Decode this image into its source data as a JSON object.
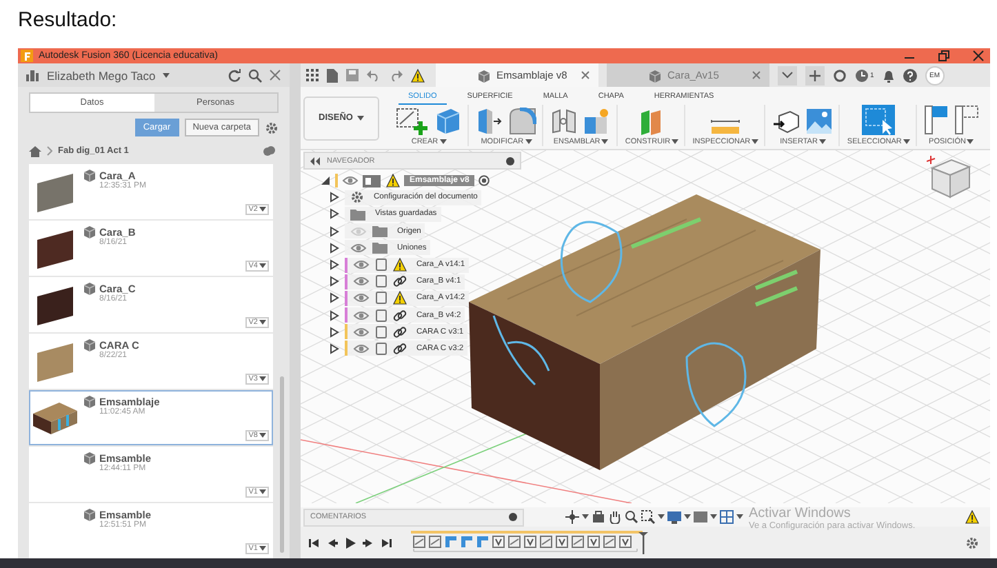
{
  "heading": "Resultado:",
  "window": {
    "title": "Autodesk Fusion 360 (Licencia educativa)"
  },
  "data_panel": {
    "user": "Elizabeth Mego Taco",
    "tabs": [
      {
        "label": "Datos",
        "selected": true
      },
      {
        "label": "Personas",
        "selected": false
      }
    ],
    "buttons": [
      {
        "label": "Cargar",
        "kind": "primary"
      },
      {
        "label": "Nueva carpeta",
        "kind": "secondary"
      }
    ],
    "breadcrumb": "Fab dig_01 Act 1",
    "files": [
      {
        "name": "Cara_A",
        "date": "12:35:31 PM",
        "version": "V2",
        "kind": "panel",
        "color": "#77736a",
        "selected": false
      },
      {
        "name": "Cara_B",
        "date": "8/16/21",
        "version": "V4",
        "kind": "panel",
        "color": "#4e2a22",
        "selected": false
      },
      {
        "name": "Cara_C",
        "date": "8/16/21",
        "version": "V2",
        "kind": "panel",
        "color": "#3a211c",
        "selected": false
      },
      {
        "name": "CARA C",
        "date": "8/22/21",
        "version": "V3",
        "kind": "panel",
        "color": "#a88b62",
        "selected": false
      },
      {
        "name": "Emsamblaje",
        "date": "11:02:45 AM",
        "version": "V8",
        "kind": "assembly",
        "selected": true
      },
      {
        "name": "Emsamble",
        "date": "12:44:11 PM",
        "version": "V1",
        "kind": "empty",
        "selected": false
      },
      {
        "name": "Emsamble",
        "date": "12:51:51 PM",
        "version": "V1",
        "kind": "empty",
        "selected": false
      }
    ]
  },
  "document_tabs": [
    {
      "label": "Emsamblaje v8",
      "selected": true
    },
    {
      "label": "Cara_Av15",
      "selected": false
    }
  ],
  "job_count": "1",
  "avatar": "EM",
  "ribbon": {
    "workspace": "DISEÑO",
    "tabs": [
      {
        "label": "SOLIDO",
        "selected": true
      },
      {
        "label": "SUPERFICIE",
        "selected": false
      },
      {
        "label": "MALLA",
        "selected": false
      },
      {
        "label": "CHAPA",
        "selected": false
      },
      {
        "label": "HERRAMIENTAS",
        "selected": false
      }
    ],
    "groups": [
      "CREAR",
      "MODIFICAR",
      "ENSAMBLAR",
      "CONSTRUIR",
      "INSPECCIONAR",
      "INSERTAR",
      "SELECCIONAR",
      "POSICIÓN"
    ]
  },
  "navigator": {
    "title": "NAVEGADOR",
    "root": {
      "label": "Emsamblaje v8",
      "expanded": true,
      "children": [
        {
          "label": "Configuración del documento",
          "kind": "settings",
          "expanded": false
        },
        {
          "label": "Vistas guardadas",
          "kind": "folder",
          "expanded": false
        },
        {
          "label": "Origen",
          "kind": "folder",
          "visible": false,
          "expanded": false
        },
        {
          "label": "Uniones",
          "kind": "folder",
          "visible": true,
          "expanded": false
        },
        {
          "label": "Cara_A v14:1",
          "kind": "component-warning",
          "visible": true,
          "color": "#d77fd7",
          "expanded": false
        },
        {
          "label": "Cara_B v4:1",
          "kind": "component-linked",
          "visible": true,
          "color": "#d77fd7",
          "expanded": false
        },
        {
          "label": "Cara_A v14:2",
          "kind": "component-warning",
          "visible": true,
          "color": "#d77fd7",
          "expanded": false
        },
        {
          "label": "Cara_B v4:2",
          "kind": "component-linked",
          "visible": true,
          "color": "#d77fd7",
          "expanded": false
        },
        {
          "label": "CARA C v3:1",
          "kind": "component-linked",
          "visible": true,
          "color": "#f2c45a",
          "expanded": false
        },
        {
          "label": "CARA C v3:2",
          "kind": "component-linked",
          "visible": true,
          "color": "#f2c45a",
          "expanded": false
        }
      ]
    }
  },
  "comments": {
    "title": "COMENTARIOS"
  },
  "activation_notice": {
    "title": "Activar Windows",
    "text": "Ve a Configuración para activar Windows."
  }
}
